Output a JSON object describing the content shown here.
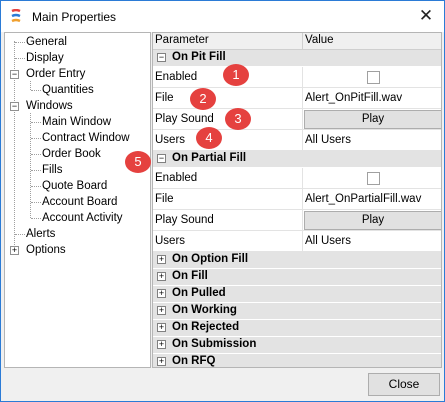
{
  "window": {
    "title": "Main Properties",
    "close_glyph": "✕"
  },
  "tree": {
    "items": [
      {
        "label": "General",
        "expander": null
      },
      {
        "label": "Display",
        "expander": null
      },
      {
        "label": "Order Entry",
        "expander": "⊟"
      },
      {
        "label": "Quantities",
        "expander": null
      },
      {
        "label": "Windows",
        "expander": "⊟"
      },
      {
        "label": "Main Window",
        "expander": null
      },
      {
        "label": "Contract Window",
        "expander": null
      },
      {
        "label": "Order Book",
        "expander": null
      },
      {
        "label": "Fills",
        "expander": null
      },
      {
        "label": "Quote Board",
        "expander": null
      },
      {
        "label": "Account Board",
        "expander": null
      },
      {
        "label": "Account Activity",
        "expander": null
      },
      {
        "label": "Alerts",
        "expander": null
      },
      {
        "label": "Options",
        "expander": "⊞"
      }
    ]
  },
  "grid": {
    "header": {
      "parameter": "Parameter",
      "value": "Value"
    },
    "categories": {
      "on_pit_fill": {
        "label": "On Pit Fill",
        "glyph": "−"
      },
      "on_partial_fill": {
        "label": "On Partial Fill",
        "glyph": "−"
      },
      "on_option_fill": {
        "label": "On Option Fill",
        "glyph": "+"
      },
      "on_fill": {
        "label": "On Fill",
        "glyph": "+"
      },
      "on_pulled": {
        "label": "On Pulled",
        "glyph": "+"
      },
      "on_working": {
        "label": "On Working",
        "glyph": "+"
      },
      "on_rejected": {
        "label": "On Rejected",
        "glyph": "+"
      },
      "on_submission": {
        "label": "On Submission",
        "glyph": "+"
      },
      "on_rfq": {
        "label": "On RFQ",
        "glyph": "+"
      }
    },
    "pit_fill": {
      "enabled_label": "Enabled",
      "file_label": "File",
      "file_value": "Alert_OnPitFill.wav",
      "play_sound_label": "Play Sound",
      "play_button": "Play",
      "users_label": "Users",
      "users_value": "All Users"
    },
    "partial_fill": {
      "enabled_label": "Enabled",
      "file_label": "File",
      "file_value": "Alert_OnPartialFill.wav",
      "play_sound_label": "Play Sound",
      "play_button": "Play",
      "users_label": "Users",
      "users_value": "All Users"
    }
  },
  "badges": [
    "1",
    "2",
    "3",
    "4",
    "5"
  ],
  "footer": {
    "close_button": "Close"
  },
  "colors": {
    "badge": "#e5413f",
    "accent_border": "#2b7bd6"
  }
}
